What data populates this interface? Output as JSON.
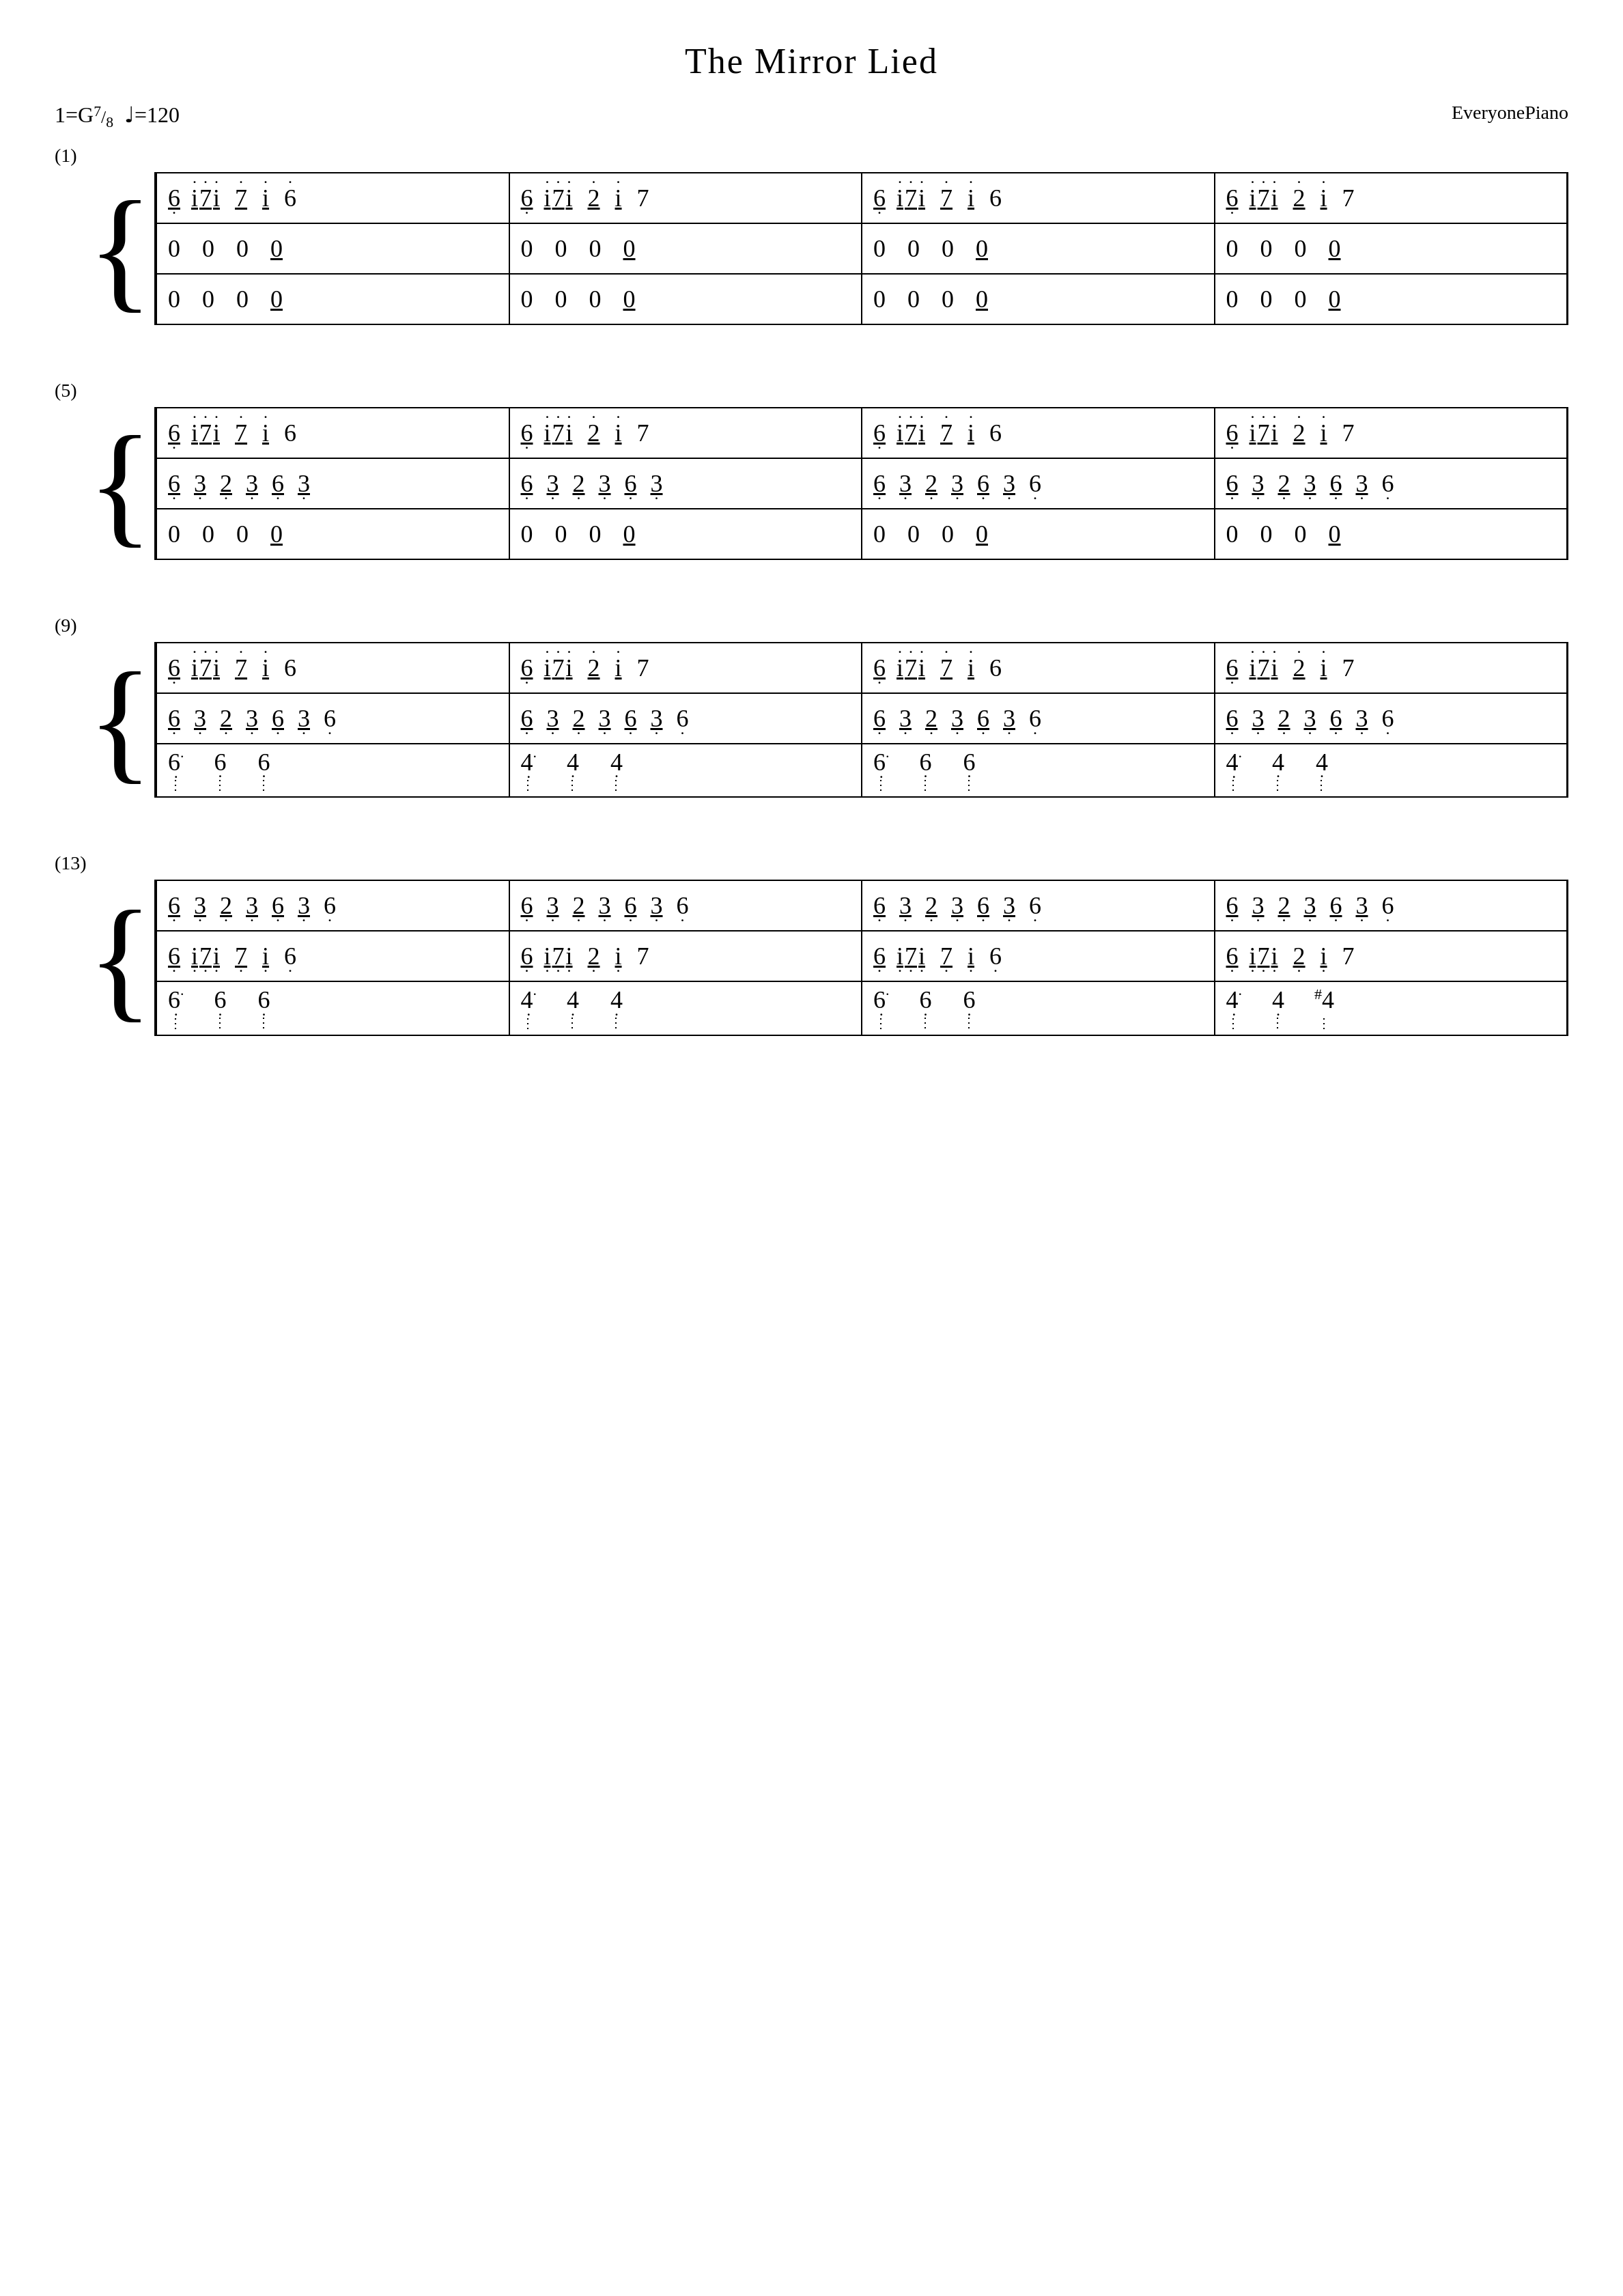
{
  "title": "The Mirror Lied",
  "key": "1=G",
  "time_sig": {
    "num": "7",
    "den": "8"
  },
  "tempo": "♩=120",
  "attribution": "EveryonePiano",
  "sections": [
    {
      "number": "(1)"
    },
    {
      "number": "(5)"
    },
    {
      "number": "(9)"
    },
    {
      "number": "(13)"
    }
  ]
}
